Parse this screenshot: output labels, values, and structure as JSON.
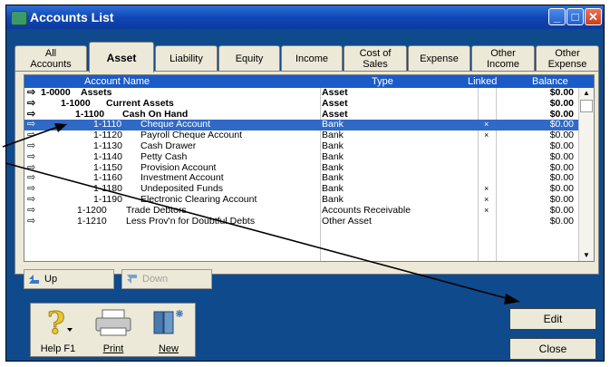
{
  "window": {
    "title": "Accounts List"
  },
  "tabs": [
    {
      "label": "All\nAccounts"
    },
    {
      "label": "Asset"
    },
    {
      "label": "Liability"
    },
    {
      "label": "Equity"
    },
    {
      "label": "Income"
    },
    {
      "label": "Cost of\nSales"
    },
    {
      "label": "Expense"
    },
    {
      "label": "Other\nIncome"
    },
    {
      "label": "Other\nExpense"
    }
  ],
  "grid": {
    "columns": {
      "name": "Account Name",
      "type": "Type",
      "linked": "Linked",
      "balance": "Balance"
    },
    "rows": [
      {
        "number": "1-0000",
        "name": "Assets",
        "type": "Asset",
        "linked": "",
        "balance": "$0.00",
        "level": 0,
        "header": true,
        "selected": false
      },
      {
        "number": "1-1000",
        "name": "Current Assets",
        "type": "Asset",
        "linked": "",
        "balance": "$0.00",
        "level": 1,
        "header": true,
        "selected": false
      },
      {
        "number": "1-1100",
        "name": "Cash On Hand",
        "type": "Asset",
        "linked": "",
        "balance": "$0.00",
        "level": 2,
        "header": true,
        "selected": false
      },
      {
        "number": "1-1110",
        "name": "Cheque Account",
        "type": "Bank",
        "linked": "×",
        "balance": "$0.00",
        "level": 3,
        "header": false,
        "selected": true
      },
      {
        "number": "1-1120",
        "name": "Payroll Cheque Account",
        "type": "Bank",
        "linked": "×",
        "balance": "$0.00",
        "level": 3,
        "header": false,
        "selected": false
      },
      {
        "number": "1-1130",
        "name": "Cash Drawer",
        "type": "Bank",
        "linked": "",
        "balance": "$0.00",
        "level": 3,
        "header": false,
        "selected": false
      },
      {
        "number": "1-1140",
        "name": "Petty Cash",
        "type": "Bank",
        "linked": "",
        "balance": "$0.00",
        "level": 3,
        "header": false,
        "selected": false
      },
      {
        "number": "1-1150",
        "name": "Provision Account",
        "type": "Bank",
        "linked": "",
        "balance": "$0.00",
        "level": 3,
        "header": false,
        "selected": false
      },
      {
        "number": "1-1160",
        "name": "Investment Account",
        "type": "Bank",
        "linked": "",
        "balance": "$0.00",
        "level": 3,
        "header": false,
        "selected": false
      },
      {
        "number": "1-1180",
        "name": "Undeposited Funds",
        "type": "Bank",
        "linked": "×",
        "balance": "$0.00",
        "level": 3,
        "header": false,
        "selected": false
      },
      {
        "number": "1-1190",
        "name": "Electronic Clearing Account",
        "type": "Bank",
        "linked": "×",
        "balance": "$0.00",
        "level": 3,
        "header": false,
        "selected": false
      },
      {
        "number": "1-1200",
        "name": "Trade Debtors",
        "type": "Accounts Receivable",
        "linked": "×",
        "balance": "$0.00",
        "level": 2,
        "header": false,
        "selected": false
      },
      {
        "number": "1-1210",
        "name": "Less Prov'n for Doubtful Debts",
        "type": "Other Asset",
        "linked": "",
        "balance": "$0.00",
        "level": 2,
        "header": false,
        "selected": false
      }
    ]
  },
  "nav": {
    "up": "Up",
    "down": "Down"
  },
  "toolbar": {
    "help": "Help F1",
    "print": "Print",
    "new": "New"
  },
  "actions": {
    "edit": "Edit",
    "close": "Close"
  },
  "icons": [
    "arrow-right-icon",
    "help-icon",
    "printer-icon",
    "new-account-icon"
  ]
}
